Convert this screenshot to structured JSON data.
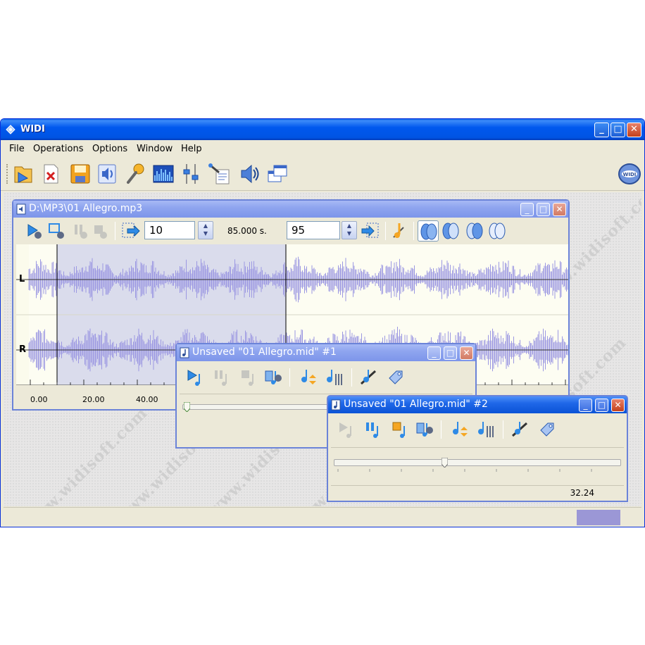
{
  "app": {
    "title": "WIDI",
    "menu": [
      "File",
      "Operations",
      "Options",
      "Window",
      "Help"
    ],
    "toolbar_icons": [
      "open-file-icon",
      "close-file-icon",
      "save-icon",
      "audio-settings-icon",
      "microphone-icon",
      "spectrum-icon",
      "mixer-icon",
      "wizard-icon",
      "speaker-icon",
      "windows-icon"
    ],
    "logo_icon": "widi-logo-icon",
    "watermark": "www.widisoft.com"
  },
  "wave_window": {
    "title": "D:\\MP3\\01 Allegro.mp3",
    "start_value": "10",
    "duration_label": "85.000 s.",
    "end_value": "95",
    "channel_left": "L",
    "channel_right": "R",
    "ruler_labels": [
      "0.00",
      "20.00",
      "40.00"
    ]
  },
  "midi_window_1": {
    "title": "Unsaved \"01 Allegro.mid\" #1"
  },
  "midi_window_2": {
    "title": "Unsaved \"01 Allegro.mid\" #2",
    "position_value": "32.24"
  },
  "colors": {
    "waveform": "#9c98e2",
    "selection": "#dadcec",
    "xp_blue": "#0054e3",
    "status_accent": "#9b97d6"
  }
}
